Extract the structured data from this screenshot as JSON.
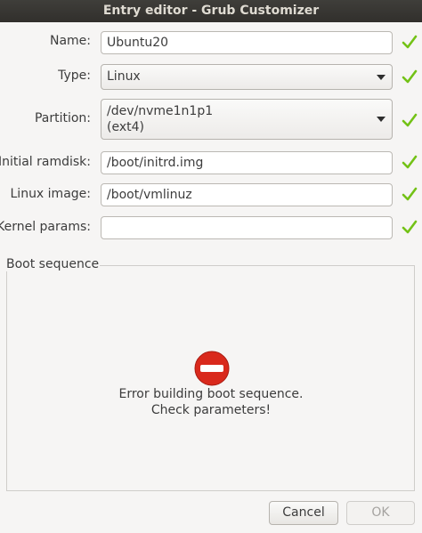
{
  "window": {
    "title": "Entry editor - Grub Customizer"
  },
  "form": {
    "name": {
      "label": "Name:",
      "value": "Ubuntu20"
    },
    "type": {
      "label": "Type:",
      "value": "Linux"
    },
    "partition": {
      "label": "Partition:",
      "value_line1": "/dev/nvme1n1p1",
      "value_line2": "(ext4)"
    },
    "initial_ramdisk": {
      "label": "Initial ramdisk:",
      "value": "/boot/initrd.img"
    },
    "linux_image": {
      "label": "Linux image:",
      "value": "/boot/vmlinuz"
    },
    "kernel_params": {
      "label": "Kernel params:",
      "value": ""
    }
  },
  "boot_sequence": {
    "label": "Boot sequence",
    "error_line1": "Error building boot sequence.",
    "error_line2": "Check parameters!",
    "icon": "error-icon"
  },
  "buttons": {
    "cancel": "Cancel",
    "ok": "OK"
  },
  "colors": {
    "check": "#73c216",
    "error": "#d9291c"
  },
  "icons": {
    "valid": "check-icon",
    "dropdown": "chevron-down-icon"
  }
}
